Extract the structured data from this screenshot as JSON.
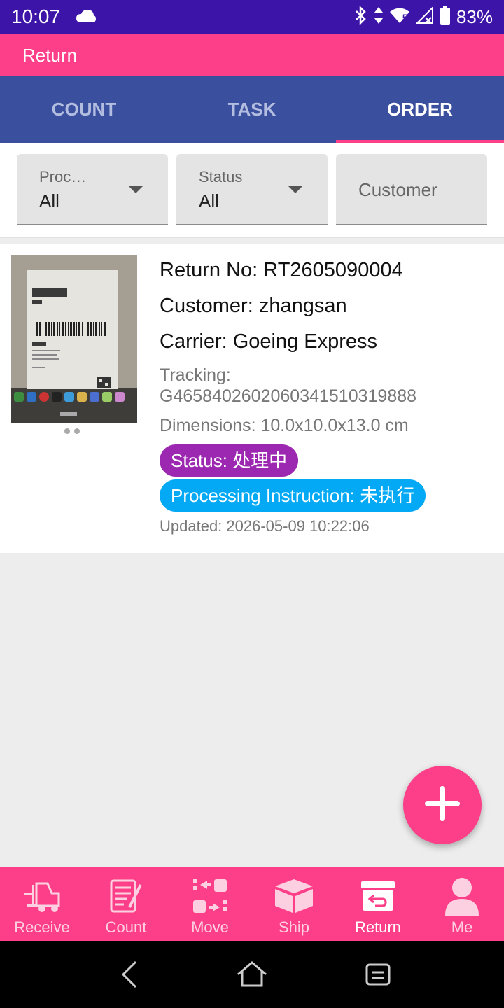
{
  "status_bar": {
    "time": "10:07",
    "battery": "83%",
    "signal_badge": "5"
  },
  "app_bar": {
    "title": "Return"
  },
  "tabs": [
    {
      "label": "COUNT",
      "active": false
    },
    {
      "label": "TASK",
      "active": false
    },
    {
      "label": "ORDER",
      "active": true
    }
  ],
  "filters": {
    "processing": {
      "label": "Proc…",
      "value": "All"
    },
    "status": {
      "label": "Status",
      "value": "All"
    },
    "customer": {
      "placeholder": "Customer"
    }
  },
  "order": {
    "return_no": "Return No: RT2605090004",
    "customer": "Customer: zhangsan",
    "carrier": "Carrier: Goeing Express",
    "tracking_label": "Tracking:",
    "tracking_value": "G4658402602060341510319888",
    "dimensions": "Dimensions: 10.0x10.0x13.0 cm",
    "status_badge": "Status: 处理中",
    "processing_badge": "Processing Instruction: 未执行",
    "updated": "Updated: 2026-05-09 10:22:06",
    "photo_label_text": "Goeing Express"
  },
  "bottom_nav": [
    {
      "label": "Receive",
      "icon": "forklift-icon",
      "active": false
    },
    {
      "label": "Count",
      "icon": "checklist-icon",
      "active": false
    },
    {
      "label": "Move",
      "icon": "move-icon",
      "active": false
    },
    {
      "label": "Ship",
      "icon": "box-icon",
      "active": false
    },
    {
      "label": "Return",
      "icon": "return-box-icon",
      "active": true
    },
    {
      "label": "Me",
      "icon": "person-icon",
      "active": false
    }
  ],
  "colors": {
    "status_bar": "#3d14a8",
    "accent_pink": "#fc3f88",
    "tab_bar": "#3a4f9e",
    "status_badge": "#9c27b0",
    "processing_badge": "#03a9f4"
  }
}
